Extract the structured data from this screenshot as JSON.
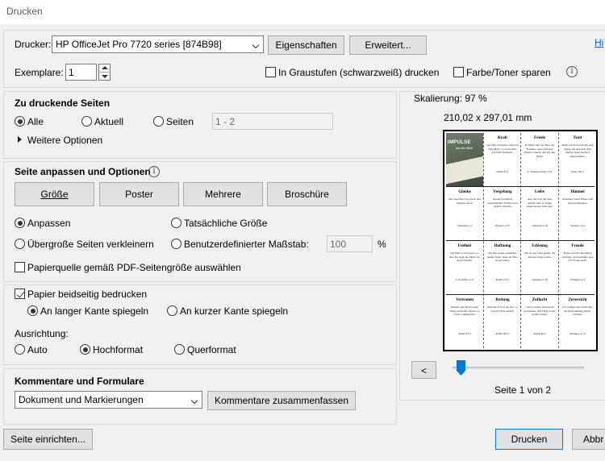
{
  "window": {
    "title": "Drucken"
  },
  "printer": {
    "label": "Drucker:",
    "selected": "HP OfficeJet Pro 7720 series [874B98]",
    "properties_button": "Eigenschaften",
    "advanced_button": "Erweitert...",
    "help_link": "Hi"
  },
  "copies": {
    "label": "Exemplare:",
    "value": "1"
  },
  "grayscale": {
    "label": "In Graustufen (schwarzweiß) drucken",
    "checked": false
  },
  "save_ink": {
    "label": "Farbe/Toner sparen",
    "checked": false
  },
  "pages": {
    "title": "Zu druckende Seiten",
    "all": "Alle",
    "current": "Aktuell",
    "pages": "Seiten",
    "range_placeholder": "1 - 2",
    "more_options": "Weitere Optionen"
  },
  "fit": {
    "title": "Seite anpassen und Optionen",
    "tabs": [
      "Größe",
      "Poster",
      "Mehrere",
      "Broschüre"
    ],
    "fit": "Anpassen",
    "actual_size": "Tatsächliche Größe",
    "shrink": "Übergroße Seiten verkleinern",
    "custom_scale": "Benutzerdefinierter Maßstab:",
    "scale_value": "100",
    "percent": "%",
    "pdf_paper": "Papierquelle gemäß PDF-Seitengröße auswählen"
  },
  "duplex": {
    "label": "Papier beidseitig bedrucken",
    "checked": true,
    "long_edge": "An langer Kante spiegeln",
    "short_edge": "An kurzer Kante spiegeln"
  },
  "orientation": {
    "label": "Ausrichtung:",
    "auto": "Auto",
    "portrait": "Hochformat",
    "landscape": "Querformat"
  },
  "comments": {
    "title": "Kommentare und Formulare",
    "selected": "Dokument und Markierungen",
    "summarize_button": "Kommentare zusammenfassen"
  },
  "preview": {
    "scaling": "Skalierung:  97 %",
    "dimensions": "210,02 x 297,01 mm",
    "prev_button": "<",
    "page_info": "Seite 1 von 2",
    "cover_title": "IMPULSE",
    "cover_subtitle": "aus der Bibel",
    "cards": [
      {
        "title": "Kraft",
        "text": "Der Herr ist meine Licht und mein Heil; vor wem sollte ich mich fürchten?",
        "ref": "Psalm 27,1"
      },
      {
        "title": "Friede",
        "text": "Er selbst aber, der Herr des Friedens, gebe euch den Frieden allezeit und auf alle Weise.",
        "ref": "2. Thessalonicher 3,16"
      },
      {
        "title": "Trost",
        "text": "Siehe, um Trost war mir sehr bange. Du aber hast dich meiner Seele herzlich angenommen.",
        "ref": "Jesaja 38,17"
      },
      {
        "title": "Glaube",
        "text": "Der Gerechte wird durch den Glauben leben.",
        "ref": "Habakuk 2,4"
      },
      {
        "title": "Vergebung",
        "text": "Werdet freundlich untereinander, herzlich und vergebt einander.",
        "ref": "Epheser 4,32"
      },
      {
        "title": "Liebe",
        "text": "Also hat Gott die Welt geliebt, dass er seinen eingeborenen Sohn gab.",
        "ref": "Johannes 3,16"
      },
      {
        "title": "Himmel",
        "text": "In meines Vaters Hause sind viele Wohnungen.",
        "ref": "Johannes 14,2"
      },
      {
        "title": "Freiheit",
        "text": "Der Herr ist der Geist; wo aber der Geist des Herrn ist, da ist Freiheit.",
        "ref": "2. Korinther 3,17"
      },
      {
        "title": "Hoffnung",
        "text": "Sei nun wieder zufrieden, meine Seele; denn der Herr tut dir Gutes.",
        "ref": "Psalm 116,7"
      },
      {
        "title": "Erlösung",
        "text": "Wer an den Sohn glaubt, der hat das ewige Leben.",
        "ref": "Johannes 3,36"
      },
      {
        "title": "Freude",
        "text": "Freuet euch in dem Herrn allewege, und abermals sage ich: Freuet euch!",
        "ref": "Philipper 4,4"
      },
      {
        "title": "Vertrauen",
        "text": "Befiehl dem Herrn deine Wege und hoffe auf ihn, er wird's wohlmachen.",
        "ref": "Psalm 37,5"
      },
      {
        "title": "Rettung",
        "text": "Rufe mich an in der Not, so will ich dich erretten.",
        "ref": "Psalm 50,15"
      },
      {
        "title": "Zuflucht",
        "text": "Gott ist unsere Zuversicht und Stärke, eine Hilfe in den großen Nöten.",
        "ref": "Psalm 46,2"
      },
      {
        "title": "Zuversicht",
        "text": "Ich vermag alles durch den, der mich mächtig macht, Christus.",
        "ref": "Philipper 4,13"
      }
    ]
  },
  "footer": {
    "page_setup_button": "Seite einrichten...",
    "print_button": "Drucken",
    "cancel_button": "Abbr"
  }
}
